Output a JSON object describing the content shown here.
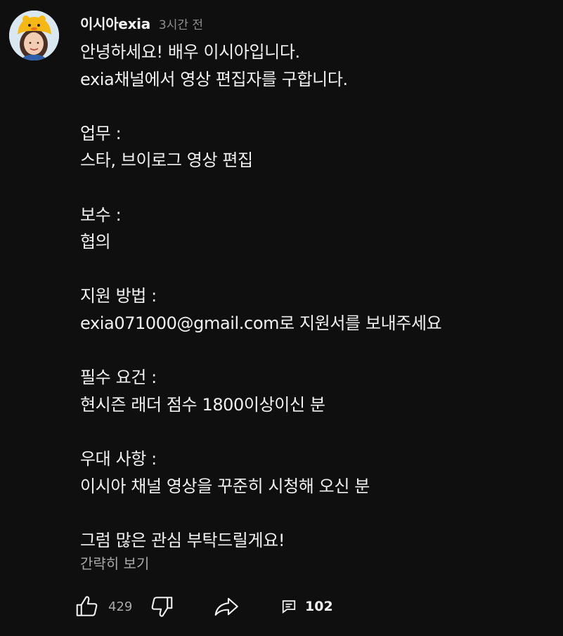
{
  "comment": {
    "author": "이시아exia",
    "time": "3시간 전",
    "lines": [
      "안녕하세요! 배우 이시아입니다.",
      "exia채널에서 영상 편집자를 구합니다.",
      "",
      "업무 :",
      "스타, 브이로그 영상 편집",
      "",
      "보수 :",
      "협의",
      "",
      "지원 방법 :",
      "exia071000@gmail.com로 지원서를 보내주세요",
      "",
      "필수 요건 :",
      "현시즌 래더 점수 1800이상이신 분",
      "",
      "우대 사항 :",
      "이시아 채널 영상을 꾸준히 시청해 오신 분",
      "",
      "그럼 많은 관심 부탁드릴게요!"
    ],
    "collapse_label": "간략히 보기",
    "likes": "429",
    "replies": "102"
  },
  "icons": {
    "avatar": "avatar-image",
    "like": "thumbs-up-icon",
    "dislike": "thumbs-down-icon",
    "share": "share-icon",
    "reply": "comment-icon"
  },
  "colors": {
    "background": "#0f0f0f",
    "text": "#f1f1f1",
    "secondary_text": "#aaaaaa"
  }
}
